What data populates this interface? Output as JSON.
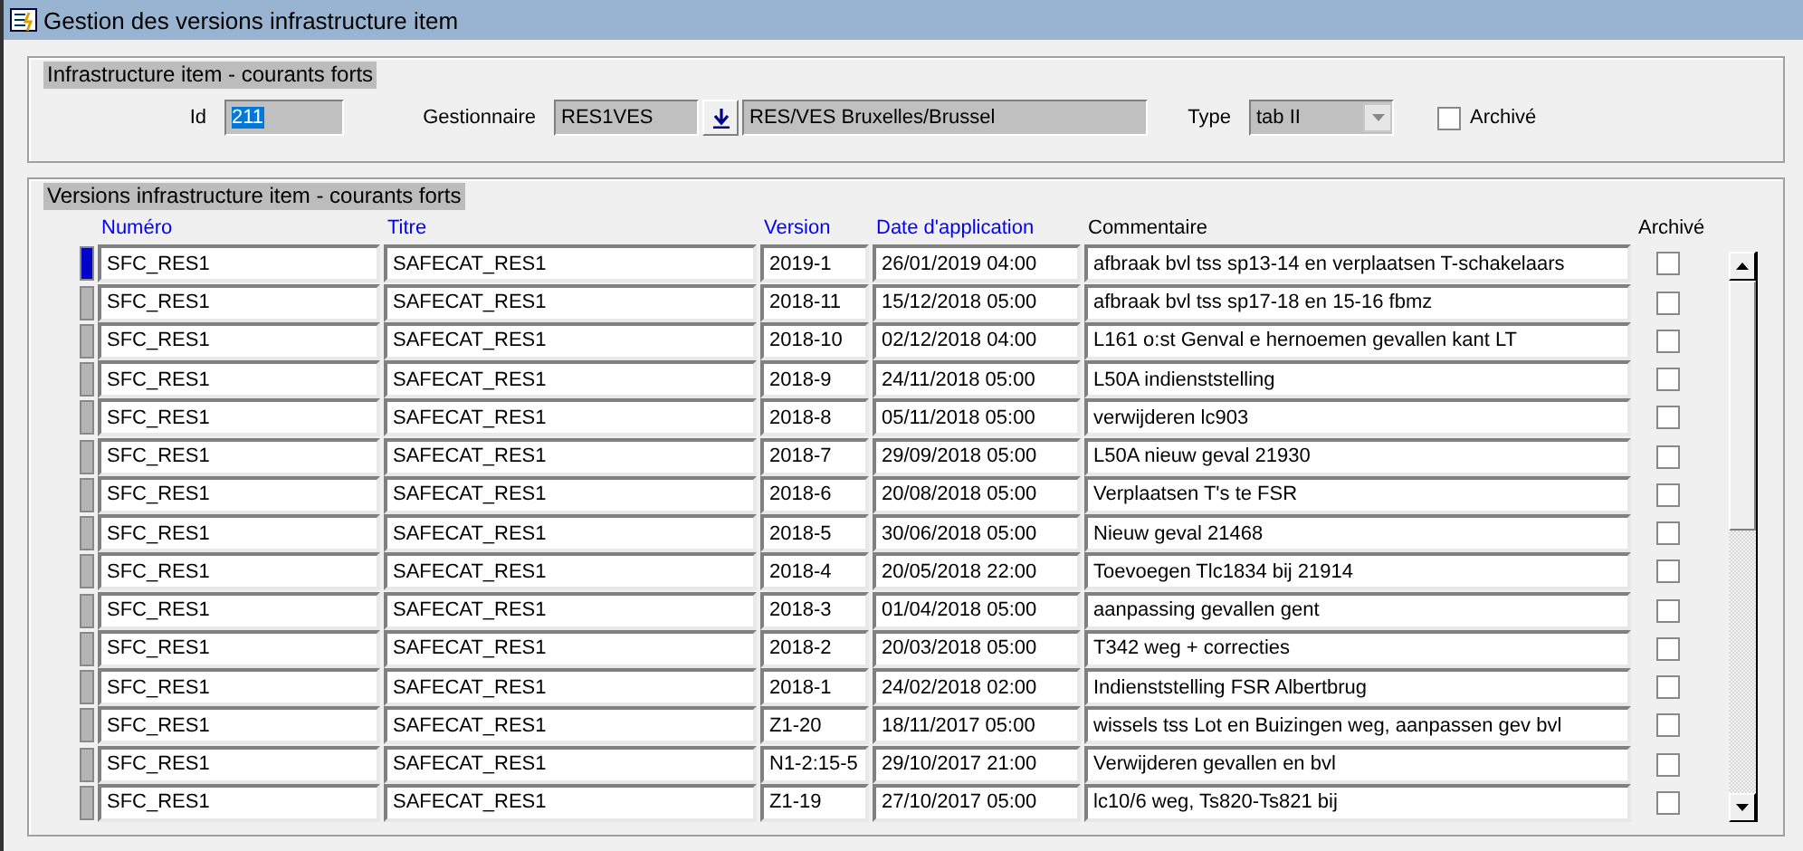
{
  "window": {
    "title": "Gestion des versions infrastructure item"
  },
  "header": {
    "title": "Infrastructure item - courants forts",
    "id_label": "Id",
    "id_value": "211",
    "manager_label": "Gestionnaire",
    "manager_code": "RES1VES",
    "manager_name": "RES/VES Bruxelles/Brussel",
    "type_label": "Type",
    "type_value": "tab II",
    "archived_label": "Archivé",
    "archived": false
  },
  "versions": {
    "title": "Versions infrastructure item - courants forts",
    "columns": [
      {
        "label": "Numéro",
        "link": true
      },
      {
        "label": "Titre",
        "link": true
      },
      {
        "label": "Version",
        "link": true
      },
      {
        "label": "Date d'application",
        "link": true
      },
      {
        "label": "Commentaire",
        "link": false
      },
      {
        "label": "Archivé",
        "link": false
      }
    ],
    "rows": [
      {
        "number": "SFC_RES1",
        "title": "SAFECAT_RES1",
        "version": "2019-1",
        "date": "26/01/2019 04:00",
        "comment": "afbraak bvl tss sp13-14 en verplaatsen T-schakelaars",
        "archived": false,
        "selected": true
      },
      {
        "number": "SFC_RES1",
        "title": "SAFECAT_RES1",
        "version": "2018-11",
        "date": "15/12/2018 05:00",
        "comment": "afbraak bvl tss sp17-18 en 15-16 fbmz",
        "archived": false,
        "selected": false
      },
      {
        "number": "SFC_RES1",
        "title": "SAFECAT_RES1",
        "version": "2018-10",
        "date": "02/12/2018 04:00",
        "comment": "L161 o:st Genval e hernoemen gevallen kant LT",
        "archived": false,
        "selected": false
      },
      {
        "number": "SFC_RES1",
        "title": "SAFECAT_RES1",
        "version": "2018-9",
        "date": "24/11/2018 05:00",
        "comment": "L50A indienststelling",
        "archived": false,
        "selected": false
      },
      {
        "number": "SFC_RES1",
        "title": "SAFECAT_RES1",
        "version": "2018-8",
        "date": "05/11/2018 05:00",
        "comment": "verwijderen lc903",
        "archived": false,
        "selected": false
      },
      {
        "number": "SFC_RES1",
        "title": "SAFECAT_RES1",
        "version": "2018-7",
        "date": "29/09/2018 05:00",
        "comment": "L50A nieuw geval 21930",
        "archived": false,
        "selected": false
      },
      {
        "number": "SFC_RES1",
        "title": "SAFECAT_RES1",
        "version": "2018-6",
        "date": "20/08/2018 05:00",
        "comment": "Verplaatsen T's  te FSR",
        "archived": false,
        "selected": false
      },
      {
        "number": "SFC_RES1",
        "title": "SAFECAT_RES1",
        "version": "2018-5",
        "date": "30/06/2018 05:00",
        "comment": "Nieuw geval 21468",
        "archived": false,
        "selected": false
      },
      {
        "number": "SFC_RES1",
        "title": "SAFECAT_RES1",
        "version": "2018-4",
        "date": "20/05/2018 22:00",
        "comment": "Toevoegen Tlc1834 bij 21914",
        "archived": false,
        "selected": false
      },
      {
        "number": "SFC_RES1",
        "title": "SAFECAT_RES1",
        "version": "2018-3",
        "date": "01/04/2018 05:00",
        "comment": "aanpassing gevallen gent",
        "archived": false,
        "selected": false
      },
      {
        "number": "SFC_RES1",
        "title": "SAFECAT_RES1",
        "version": "2018-2",
        "date": "20/03/2018 05:00",
        "comment": "T342 weg + correcties",
        "archived": false,
        "selected": false
      },
      {
        "number": "SFC_RES1",
        "title": "SAFECAT_RES1",
        "version": "2018-1",
        "date": "24/02/2018 02:00",
        "comment": "Indienststelling FSR Albertbrug",
        "archived": false,
        "selected": false
      },
      {
        "number": "SFC_RES1",
        "title": "SAFECAT_RES1",
        "version": "Z1-20",
        "date": "18/11/2017 05:00",
        "comment": "wissels tss Lot en Buizingen weg, aanpassen gev bvl",
        "archived": false,
        "selected": false
      },
      {
        "number": "SFC_RES1",
        "title": "SAFECAT_RES1",
        "version": "N1-2:15-5",
        "date": "29/10/2017 21:00",
        "comment": "Verwijderen gevallen en bvl",
        "archived": false,
        "selected": false
      },
      {
        "number": "SFC_RES1",
        "title": "SAFECAT_RES1",
        "version": "Z1-19",
        "date": "27/10/2017 05:00",
        "comment": "lc10/6 weg, Ts820-Ts821 bij",
        "archived": false,
        "selected": false
      }
    ]
  }
}
